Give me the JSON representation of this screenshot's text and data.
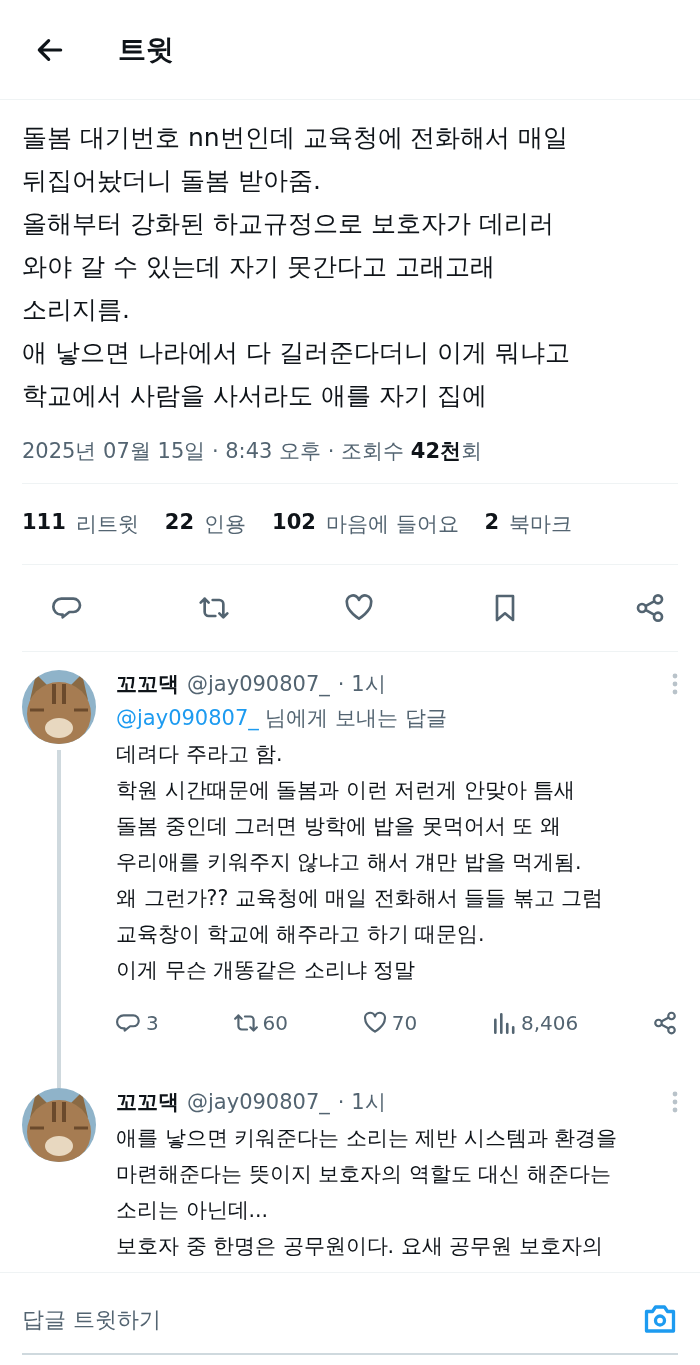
{
  "header": {
    "title": "트윗"
  },
  "tweet": {
    "lines": [
      "돌봄 대기번호 nn번인데 교육청에 전화해서 매일",
      "뒤집어놨더니 돌봄 받아줌.",
      "올해부터 강화된 하교규정으로 보호자가 데리러",
      "와야 갈 수 있는데 자기 못간다고 고래고래",
      "소리지름.",
      "애 낳으면 나라에서 다 길러준다더니 이게 뭐냐고",
      "학교에서 사람을 사서라도 애를 자기 집에"
    ],
    "meta": "2025년 07월 15일 · 8:43 오후 · 조회수 **42천**회",
    "stats": [
      {
        "count": "111",
        "label": "리트윗"
      },
      {
        "count": "22",
        "label": "인용"
      },
      {
        "count": "102",
        "label": "마음에 들어요"
      },
      {
        "count": "2",
        "label": "북마크"
      }
    ],
    "actions": [
      {
        "kind": "reply"
      },
      {
        "kind": "retweet"
      },
      {
        "kind": "like"
      },
      {
        "kind": "bookmark"
      },
      {
        "kind": "share"
      }
    ]
  },
  "replies": [
    {
      "name": "꼬꼬댁",
      "handle": "@jay090807_",
      "time": "· 1시",
      "replying_to": {
        "mention": "@jay090807_",
        "text": "님에게 보내는 답글"
      },
      "thread_line": true,
      "lines": [
        "데려다 주라고 함.",
        "학원 시간때문에 돌봄과 이런 저런게 안맞아 틈새",
        "돌봄 중인데 그러면 방학에 밥을 못먹어서 또 왜",
        "우리애를 키워주지 않냐고 해서 걔만 밥을 먹게됨.",
        "왜 그런가?? 교육청에 매일 전화해서 들들 볶고 그럼",
        "교육창이 학교에 해주라고 하기 때문임.",
        "이게 무슨 개똥같은 소리냐 정말"
      ],
      "actions": [
        {
          "kind": "reply",
          "count": "3"
        },
        {
          "kind": "retweet",
          "count": "60"
        },
        {
          "kind": "like",
          "count": "70"
        },
        {
          "kind": "views",
          "count": "8,406"
        },
        {
          "kind": "share"
        }
      ]
    },
    {
      "name": "꼬꼬댁",
      "handle": "@jay090807_",
      "time": "· 1시",
      "thread_line": false,
      "lines": [
        "애를 낳으면 키워준다는 소리는 제반 시스템과 환경을",
        "마련해준다는 뜻이지 보호자의 역할도 대신 해준다는",
        "소리는 아닌데...",
        "보호자 중 한명은 공무원이다. 요새 공무원 보호자의"
      ]
    }
  ],
  "reply_bar": {
    "placeholder": "답글 트윗하기"
  }
}
